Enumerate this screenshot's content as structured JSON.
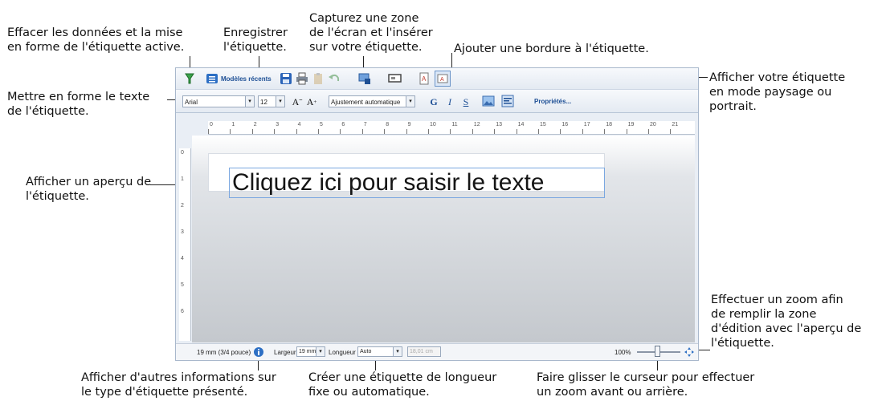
{
  "callouts": {
    "clear": "Effacer les données et la mise\nen forme de l'étiquette active.",
    "save": "Enregistrer\nl'étiquette.",
    "capture": "Capturez une zone\nde l'écran et l'insérer\nsur votre étiquette.",
    "border": "Ajouter une bordure à l'étiquette.",
    "orientation": "Afficher votre étiquette\nen mode paysage ou\nportrait.",
    "format_text": "Mettre en forme le texte\nde l'étiquette.",
    "preview": "Afficher un aperçu de\nl'étiquette.",
    "zoom_fit": "Effectuer un zoom afin\nde remplir la zone\nd'édition avec l'aperçu de\nl'étiquette.",
    "info": "Afficher d'autres informations sur\nle type d'étiquette présenté.",
    "length": "Créer une étiquette de longueur\nfixe ou automatique.",
    "slider": "Faire glisser le curseur pour effectuer\nun zoom avant ou arrière."
  },
  "toolbar": {
    "recent_label": "Modèles récents",
    "font": "Arial",
    "size": "12",
    "fit": "Ajustement automatique",
    "bold": "G",
    "italic": "I",
    "underline": "S",
    "properties": "Propriétés..."
  },
  "ruler": [
    "0",
    "1",
    "2",
    "3",
    "4",
    "5",
    "6",
    "7",
    "8",
    "9",
    "10",
    "11",
    "12",
    "13",
    "14",
    "15",
    "16",
    "17",
    "18",
    "19",
    "20",
    "21"
  ],
  "ruler_left": [
    "0",
    "1",
    "2",
    "3",
    "4",
    "5",
    "6"
  ],
  "label": {
    "text": "Cliquez ici pour saisir le texte"
  },
  "status": {
    "tape": "19 mm (3/4 pouce)",
    "width_label": "Largeur",
    "width_value": "19 mm",
    "length_label": "Longueur",
    "length_value": "Auto",
    "length_cm": "18,01 cm",
    "zoom": "100%"
  }
}
